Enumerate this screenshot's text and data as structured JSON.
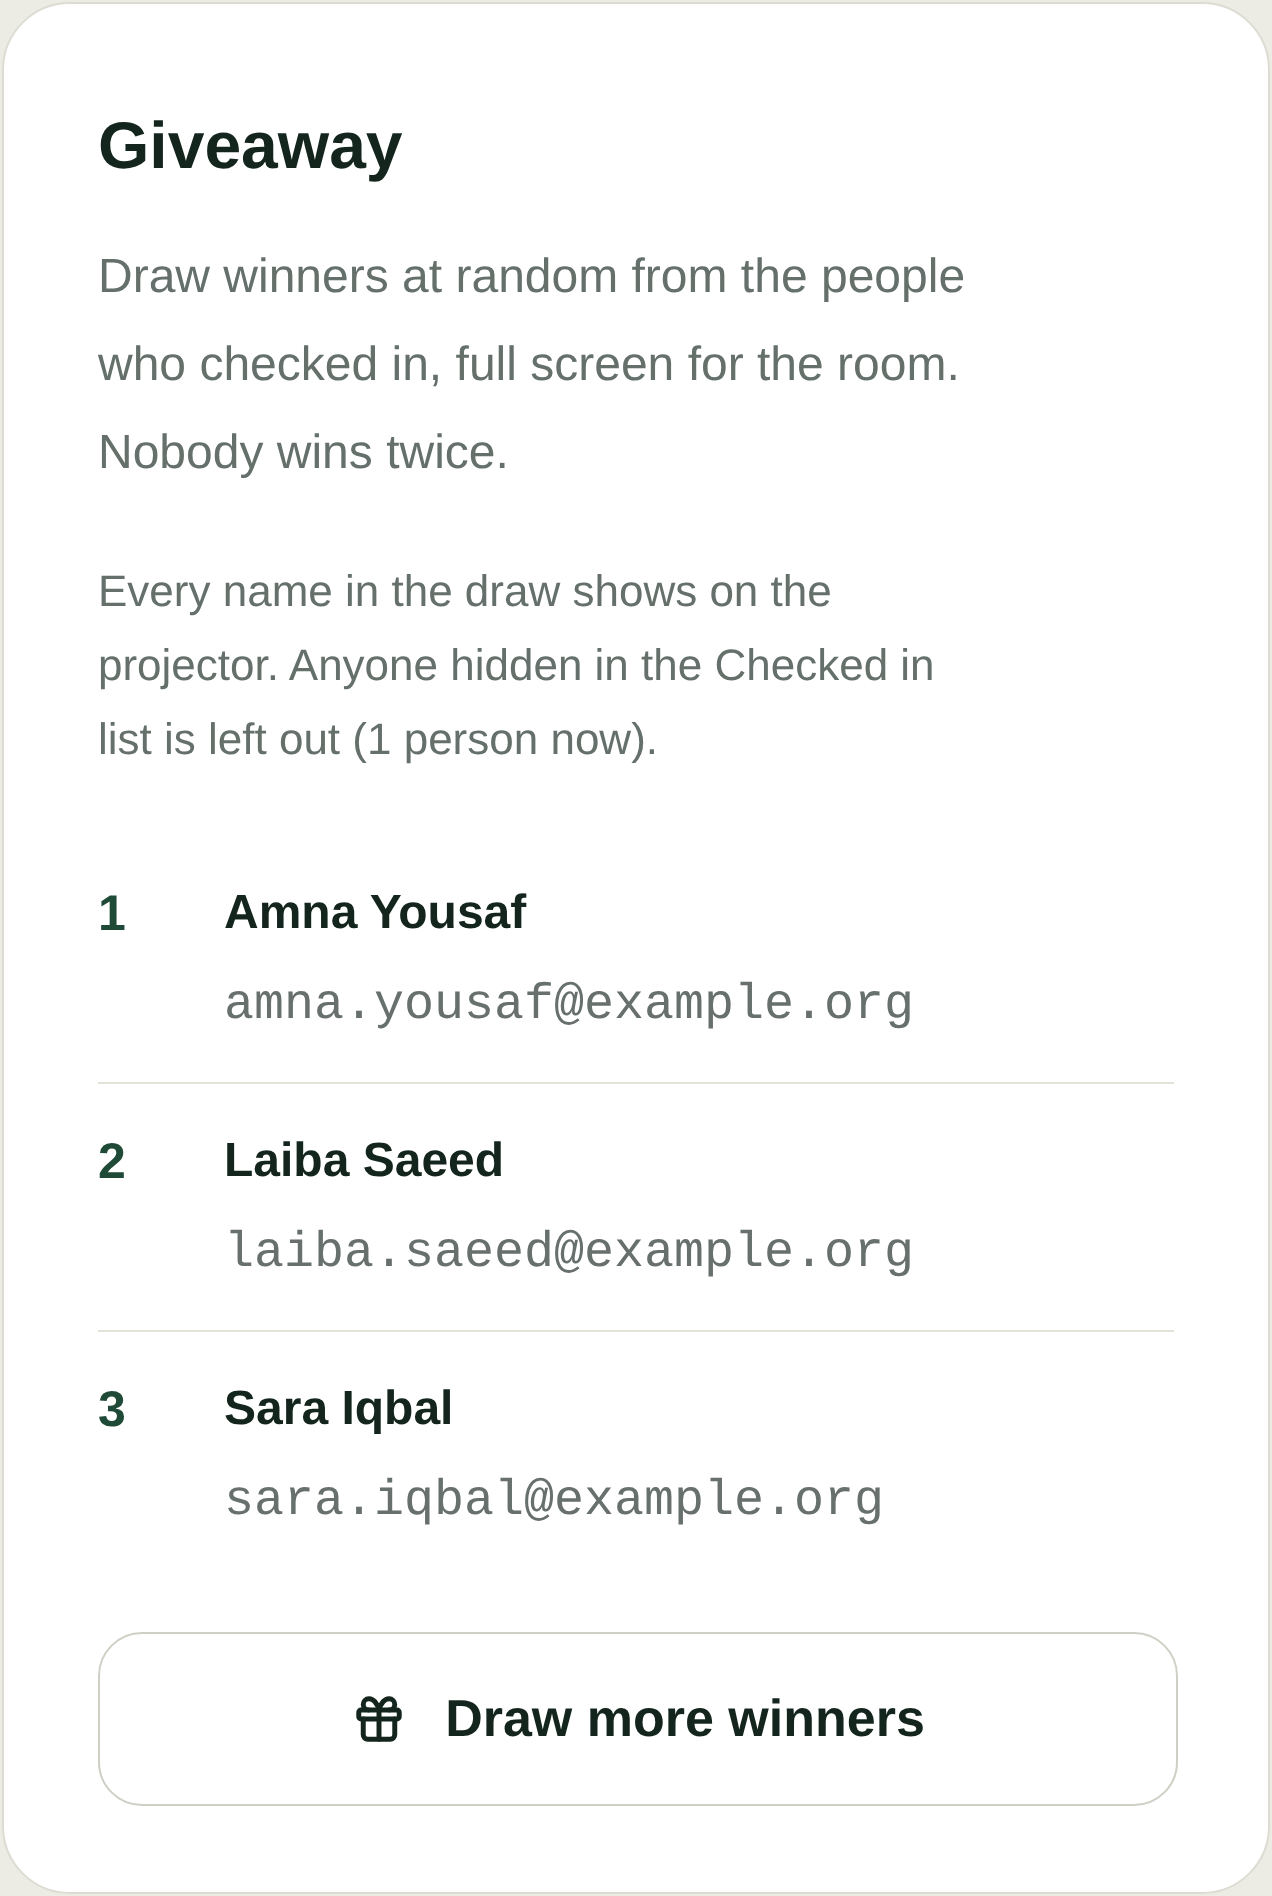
{
  "card": {
    "title": "Giveaway",
    "intro": "Draw winners at random from the people who checked in, full screen for the room. Nobody wins twice.",
    "note": "Every name in the draw shows on the projector. Anyone hidden in the Checked in list is left out (1 person now).",
    "winners": [
      {
        "rank": "1",
        "name": "Amna Yousaf",
        "email": "amna.yousaf@example.org"
      },
      {
        "rank": "2",
        "name": "Laiba Saeed",
        "email": "laiba.saeed@example.org"
      },
      {
        "rank": "3",
        "name": "Sara Iqbal",
        "email": "sara.iqbal@example.org"
      }
    ],
    "button": {
      "label": "Draw more winners"
    }
  }
}
